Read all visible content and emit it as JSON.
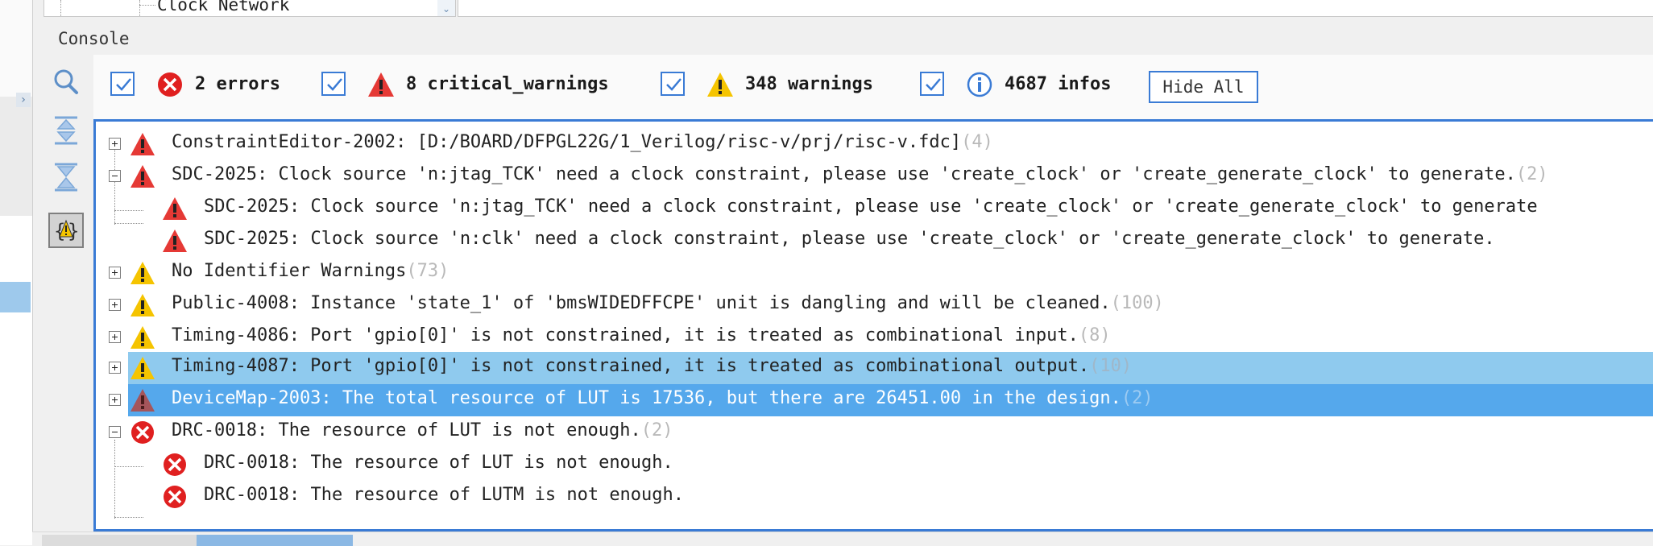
{
  "tree": {
    "visible_item": "Clock Network"
  },
  "console": {
    "title": "Console",
    "filters": {
      "errors": "2 errors",
      "critical_warnings": "8 critical_warnings",
      "warnings": "348 warnings",
      "infos": "4687 infos"
    },
    "hide_all_label": "Hide All",
    "messages": [
      {
        "severity": "critical",
        "expanded": false,
        "text": "ConstraintEditor-2002: [D:/BOARD/DFPGL22G/1_Verilog/risc-v/prj/risc-v.fdc]",
        "count": "(4)"
      },
      {
        "severity": "critical",
        "expanded": true,
        "text": "SDC-2025: Clock source 'n:jtag_TCK' need a clock constraint, please use 'create_clock' or 'create_generate_clock' to generate.",
        "count": "(2)"
      },
      {
        "severity": "critical",
        "child": true,
        "text": "SDC-2025: Clock source 'n:jtag_TCK' need a clock constraint, please use 'create_clock' or 'create_generate_clock' to generate"
      },
      {
        "severity": "critical",
        "child": true,
        "text": "SDC-2025: Clock source 'n:clk' need a clock constraint, please use 'create_clock' or 'create_generate_clock' to generate."
      },
      {
        "severity": "warning",
        "expanded": false,
        "text": "No Identifier Warnings",
        "count": "(73)"
      },
      {
        "severity": "warning",
        "expanded": false,
        "text": "Public-4008: Instance 'state_1' of 'bmsWIDEDFFCPE' unit is dangling and will be cleaned.",
        "count": "(100)"
      },
      {
        "severity": "warning",
        "expanded": false,
        "text": "Timing-4086: Port 'gpio[0]' is not constrained, it is treated as combinational input.",
        "count": "(8)"
      },
      {
        "severity": "warning",
        "expanded": false,
        "selected": "light",
        "text": "Timing-4087: Port 'gpio[0]' is not constrained, it is treated as combinational output.",
        "count": "(10)"
      },
      {
        "severity": "critical",
        "expanded": false,
        "selected": "strong",
        "text": "DeviceMap-2003: The total resource of LUT is 17536, but there are 26451.00 in the design.",
        "count": "(2)"
      },
      {
        "severity": "error",
        "expanded": true,
        "text": "DRC-0018: The resource of LUT is not enough.",
        "count": "(2)"
      },
      {
        "severity": "error",
        "child": true,
        "text": "DRC-0018: The resource of LUT is not enough."
      },
      {
        "severity": "error",
        "child": true,
        "text": "DRC-0018: The resource of LUTM is not enough."
      }
    ]
  },
  "colors": {
    "accent": "#3a7bd5",
    "error": "#e02020",
    "critical": "#e53935",
    "warning": "#f5c400",
    "info": "#3a7bd5",
    "selection_light": "#8fcaee",
    "selection_strong": "#55a8ec"
  },
  "icons": [
    "search-icon",
    "expand-all-icon",
    "collapse-all-icon",
    "filter-current-icon",
    "error-icon",
    "critical-warning-icon",
    "warning-icon",
    "info-icon",
    "checkbox-icon",
    "tree-expand-icon",
    "tree-collapse-icon"
  ]
}
